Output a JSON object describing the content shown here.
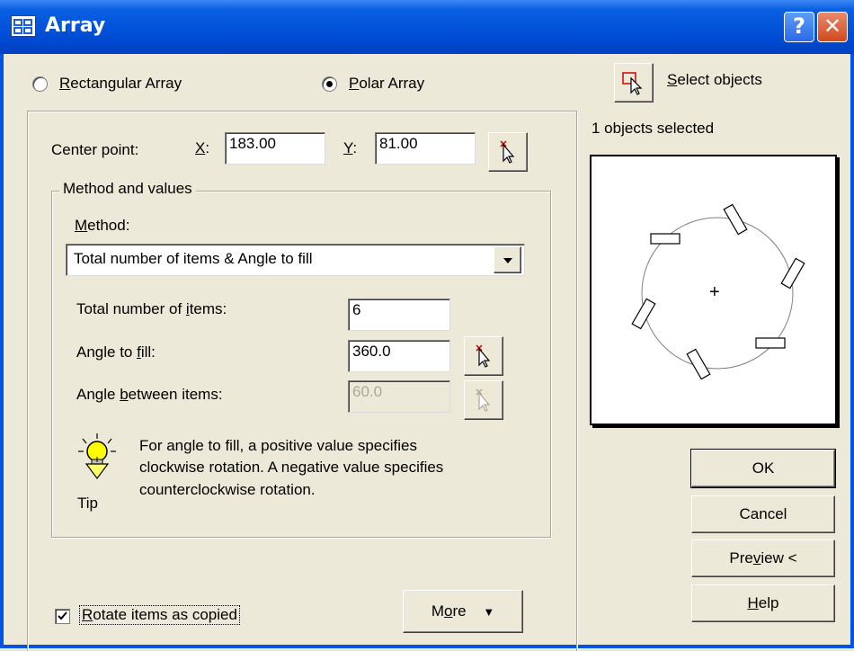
{
  "window": {
    "title": "Array",
    "help_glyph": "?",
    "close_glyph": "✕"
  },
  "array_type": {
    "rect_pre": "",
    "rect_key": "R",
    "rect_post": "ectangular Array",
    "polar_pre": "",
    "polar_key": "P",
    "polar_post": "olar Array",
    "selected": "polar"
  },
  "center_point": {
    "label": "Center point:",
    "x_key": "X",
    "x_post": ":",
    "x_value": "183.00",
    "y_key": "Y",
    "y_post": ":",
    "y_value": "81.00"
  },
  "method_group": {
    "legend": "Method and values",
    "method_key": "M",
    "method_post": "ethod:",
    "method_value": "Total number of items & Angle to fill"
  },
  "fields": {
    "total_pre": "Total number of ",
    "total_key": "i",
    "total_post": "tems:",
    "total_value": "6",
    "fill_pre": "Angle to ",
    "fill_key": "f",
    "fill_post": "ill:",
    "fill_value": "360.0",
    "between_pre": "Angle ",
    "between_key": "b",
    "between_post": "etween items:",
    "between_value": "60.0"
  },
  "tip": {
    "label": "Tip",
    "line1": "For angle to fill, a positive value specifies",
    "line2": "clockwise rotation.  A negative value specifies",
    "line3": "counterclockwise rotation."
  },
  "rotate": {
    "pre": "",
    "key": "R",
    "post": "otate items as copied",
    "checked": true
  },
  "more_button": {
    "pre": "M",
    "key": "o",
    "post": "re",
    "glyph": "▼"
  },
  "select_objects": {
    "pre": "",
    "key": "S",
    "post": "elect objects",
    "status": "1 objects selected"
  },
  "buttons": {
    "ok": "OK",
    "cancel": "Cancel",
    "preview_pre": "Pre",
    "preview_key": "v",
    "preview_post": "iew <",
    "help_pre": "",
    "help_key": "H",
    "help_post": "elp"
  },
  "preview": {
    "center_glyph": "+"
  }
}
